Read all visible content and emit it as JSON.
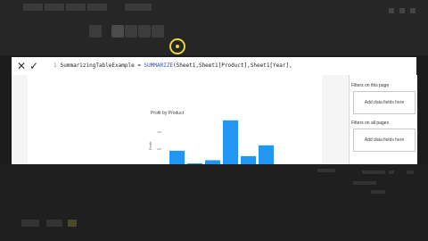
{
  "formula": {
    "line_number": "1",
    "text_prefix": "SummarizingTableExample = ",
    "function": "SUMMARIZE",
    "args": "(Sheet1,Sheet1[Product],Sheet1[Year],"
  },
  "chart_data": {
    "type": "bar",
    "title": "Profit by Product",
    "ylabel": "Profit",
    "ytick_labels": [
      "400",
      "200"
    ],
    "values": [
      2,
      0.1,
      0.6,
      6.5,
      1.2,
      2.8
    ],
    "ylim": [
      0,
      7
    ],
    "color": "#2196f3"
  },
  "panel": {
    "filters_page_label": "Filters on this page",
    "filters_page_drop": "Add data fields here",
    "filters_all_label": "Filters on all pages",
    "filters_all_drop": "Add data fields here"
  },
  "colors": {
    "accent": "#2196f3",
    "cursor": "#e8d830"
  }
}
